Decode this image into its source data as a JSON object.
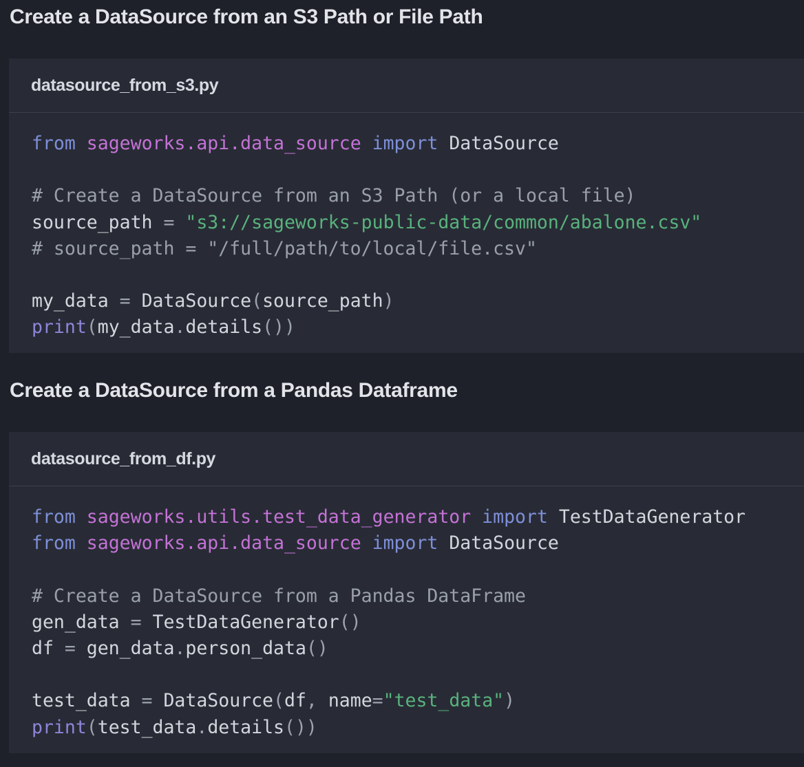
{
  "sections": [
    {
      "heading": "Create a DataSource from an S3 Path or File Path",
      "filename": "datasource_from_s3.py",
      "lines": [
        [
          [
            "kw",
            "from"
          ],
          [
            "txt",
            " "
          ],
          [
            "mod",
            "sageworks.api.data_source"
          ],
          [
            "txt",
            " "
          ],
          [
            "kw",
            "import"
          ],
          [
            "txt",
            " DataSource"
          ]
        ],
        [],
        [
          [
            "cmt",
            "# Create a DataSource from an S3 Path (or a local file)"
          ]
        ],
        [
          [
            "txt",
            "source_path "
          ],
          [
            "pun",
            "="
          ],
          [
            "txt",
            " "
          ],
          [
            "str",
            "\"s3://sageworks-public-data/common/abalone.csv\""
          ]
        ],
        [
          [
            "cmt",
            "# source_path = \"/full/path/to/local/file.csv\""
          ]
        ],
        [],
        [
          [
            "txt",
            "my_data "
          ],
          [
            "pun",
            "="
          ],
          [
            "txt",
            " DataSource"
          ],
          [
            "pun",
            "("
          ],
          [
            "txt",
            "source_path"
          ],
          [
            "pun",
            ")"
          ]
        ],
        [
          [
            "fn",
            "print"
          ],
          [
            "pun",
            "("
          ],
          [
            "txt",
            "my_data"
          ],
          [
            "pun",
            "."
          ],
          [
            "txt",
            "details"
          ],
          [
            "pun",
            "())"
          ]
        ]
      ]
    },
    {
      "heading": "Create a DataSource from a Pandas Dataframe",
      "filename": "datasource_from_df.py",
      "lines": [
        [
          [
            "kw",
            "from"
          ],
          [
            "txt",
            " "
          ],
          [
            "mod",
            "sageworks.utils.test_data_generator"
          ],
          [
            "txt",
            " "
          ],
          [
            "kw",
            "import"
          ],
          [
            "txt",
            " TestDataGenerator"
          ]
        ],
        [
          [
            "kw",
            "from"
          ],
          [
            "txt",
            " "
          ],
          [
            "mod",
            "sageworks.api.data_source"
          ],
          [
            "txt",
            " "
          ],
          [
            "kw",
            "import"
          ],
          [
            "txt",
            " DataSource"
          ]
        ],
        [],
        [
          [
            "cmt",
            "# Create a DataSource from a Pandas DataFrame"
          ]
        ],
        [
          [
            "txt",
            "gen_data "
          ],
          [
            "pun",
            "="
          ],
          [
            "txt",
            " TestDataGenerator"
          ],
          [
            "pun",
            "()"
          ]
        ],
        [
          [
            "txt",
            "df "
          ],
          [
            "pun",
            "="
          ],
          [
            "txt",
            " gen_data"
          ],
          [
            "pun",
            "."
          ],
          [
            "txt",
            "person_data"
          ],
          [
            "pun",
            "()"
          ]
        ],
        [],
        [
          [
            "txt",
            "test_data "
          ],
          [
            "pun",
            "="
          ],
          [
            "txt",
            " DataSource"
          ],
          [
            "pun",
            "("
          ],
          [
            "txt",
            "df"
          ],
          [
            "pun",
            ","
          ],
          [
            "txt",
            " name"
          ],
          [
            "pun",
            "="
          ],
          [
            "str",
            "\"test_data\""
          ],
          [
            "pun",
            ")"
          ]
        ],
        [
          [
            "fn",
            "print"
          ],
          [
            "pun",
            "("
          ],
          [
            "txt",
            "test_data"
          ],
          [
            "pun",
            "."
          ],
          [
            "txt",
            "details"
          ],
          [
            "pun",
            "())"
          ]
        ]
      ]
    }
  ]
}
